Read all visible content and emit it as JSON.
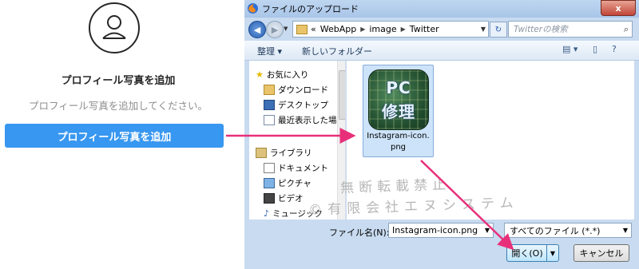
{
  "profile_panel": {
    "title": "プロフィール写真を追加",
    "subtitle": "プロフィール写真を追加してください。",
    "button_label": "プロフィール写真を追加"
  },
  "dialog": {
    "title": "ファイルのアップロード",
    "close_label": "x",
    "address": {
      "prefix": "«",
      "crumbs": [
        "WebApp",
        "image",
        "Twitter"
      ]
    },
    "search_placeholder": "Twitterの検索",
    "toolbar": {
      "organize": "整理 ▾",
      "new_folder": "新しいフォルダー"
    },
    "nav": {
      "favorites": "お気に入り",
      "downloads": "ダウンロード",
      "desktop": "デスクトップ",
      "recent": "最近表示した場所",
      "libraries": "ライブラリ",
      "documents": "ドキュメント",
      "pictures": "ピクチャ",
      "videos": "ビデオ",
      "music": "ミュージック"
    },
    "file": {
      "thumb_line1": "PC",
      "thumb_line2": "修理",
      "name_line1": "Instagram-icon.",
      "name_line2": "png"
    },
    "filename_label": "ファイル名(N):",
    "filename_value": "Instagram-icon.png",
    "filetype_value": "すべてのファイル (*.*)",
    "open_label": "開く(O)",
    "cancel_label": "キャンセル"
  },
  "watermark": {
    "line1": "無断転載禁止",
    "line2": "©有限会社エヌシステム"
  },
  "colors": {
    "accent_button": "#3897f0",
    "arrow": "#e8307a",
    "dialog_frame": "#c8dbf0"
  }
}
